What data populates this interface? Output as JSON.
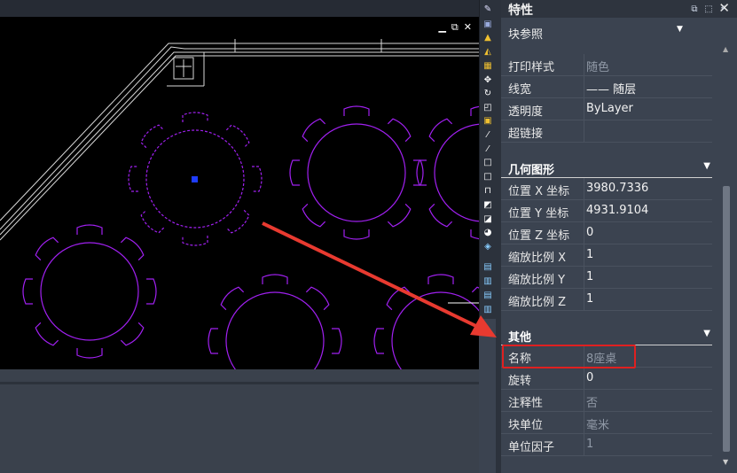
{
  "panel": {
    "title": "特性",
    "close": "✕",
    "selector": {
      "value": "块参照"
    },
    "rows_top": [
      {
        "key": "打印样式",
        "value": "随色",
        "dim": true
      },
      {
        "key": "线宽",
        "value": "—— 随层",
        "dim": false
      },
      {
        "key": "透明度",
        "value": "ByLayer",
        "dim": false
      },
      {
        "key": "超链接",
        "value": "",
        "dim": false
      }
    ],
    "sections": {
      "geometry": {
        "title": "几何图形",
        "rows": [
          {
            "key": "位置 X 坐标",
            "value": "3980.7336"
          },
          {
            "key": "位置 Y 坐标",
            "value": "4931.9104"
          },
          {
            "key": "位置 Z 坐标",
            "value": "0"
          },
          {
            "key": "缩放比例 X",
            "value": "1"
          },
          {
            "key": "缩放比例 Y",
            "value": "1"
          },
          {
            "key": "缩放比例 Z",
            "value": "1"
          }
        ]
      },
      "other": {
        "title": "其他",
        "rows": [
          {
            "key": "名称",
            "value": "8座桌",
            "dim": true
          },
          {
            "key": "旋转",
            "value": "0",
            "dim": false
          },
          {
            "key": "注释性",
            "value": "否",
            "dim": true
          },
          {
            "key": "块单位",
            "value": "毫米",
            "dim": true
          },
          {
            "key": "单位因子",
            "value": "1",
            "dim": true
          }
        ]
      }
    }
  },
  "colors": {
    "panel_bg": "#3b4350",
    "canvas_bg": "#000000",
    "table_color": "#a020f0",
    "highlight": "#e02020",
    "arrow": "#e83a30"
  },
  "canvas": {
    "window_controls": [
      "▁",
      "⧉",
      "✕"
    ]
  }
}
